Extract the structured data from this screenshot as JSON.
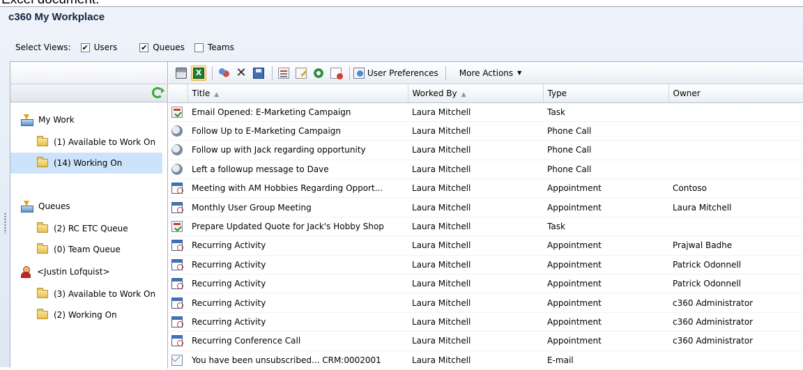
{
  "page_caption": "Excel document.",
  "app": {
    "title": "c360 My Workplace"
  },
  "views": {
    "label": "Select Views:",
    "options": [
      {
        "label": "Users",
        "checked": true
      },
      {
        "label": "Queues",
        "checked": true
      },
      {
        "label": "Teams",
        "checked": false
      }
    ],
    "check_glyph": "✔"
  },
  "toolbar": {
    "user_preferences": "User Preferences",
    "more_actions": "More Actions",
    "excel_glyph": "X",
    "delete_glyph": "✕",
    "caret": "▼"
  },
  "tree": {
    "my_work": "My Work",
    "available_to_work_on": "(1) Available to Work On",
    "working_on": "(14) Working On",
    "queues": "Queues",
    "rc_etc_queue": "(2) RC ETC Queue",
    "team_queue": "(0) Team Queue",
    "user": "<Justin Lofquist>",
    "user_available": "(3) Available to Work On",
    "user_working_on": "(2) Working On"
  },
  "grid": {
    "columns": [
      "Title",
      "Worked By",
      "Type",
      "Owner"
    ],
    "sort_glyph": "▲",
    "rows": [
      {
        "icon": "task",
        "title": "Email Opened: E-Marketing Campaign",
        "worked_by": "Laura Mitchell",
        "type": "Task",
        "owner": ""
      },
      {
        "icon": "phone",
        "title": "Follow Up to E-Marketing Campaign",
        "worked_by": "Laura Mitchell",
        "type": "Phone Call",
        "owner": ""
      },
      {
        "icon": "phone",
        "title": "Follow up with Jack regarding opportunity",
        "worked_by": "Laura Mitchell",
        "type": "Phone Call",
        "owner": ""
      },
      {
        "icon": "phone",
        "title": "Left a followup message to Dave",
        "worked_by": "Laura Mitchell",
        "type": "Phone Call",
        "owner": ""
      },
      {
        "icon": "appointment",
        "title": "Meeting with AM Hobbies Regarding Opport...",
        "worked_by": "Laura Mitchell",
        "type": "Appointment",
        "owner": "Contoso"
      },
      {
        "icon": "appointment",
        "title": "Monthly User Group Meeting",
        "worked_by": "Laura Mitchell",
        "type": "Appointment",
        "owner": "Laura Mitchell"
      },
      {
        "icon": "task",
        "title": "Prepare Updated Quote for Jack's Hobby Shop",
        "worked_by": "Laura Mitchell",
        "type": "Task",
        "owner": ""
      },
      {
        "icon": "appointment",
        "title": "Recurring Activity",
        "worked_by": "Laura Mitchell",
        "type": "Appointment",
        "owner": "Prajwal Badhe"
      },
      {
        "icon": "appointment",
        "title": "Recurring Activity",
        "worked_by": "Laura Mitchell",
        "type": "Appointment",
        "owner": "Patrick Odonnell"
      },
      {
        "icon": "appointment",
        "title": "Recurring Activity",
        "worked_by": "Laura Mitchell",
        "type": "Appointment",
        "owner": "Patrick Odonnell"
      },
      {
        "icon": "appointment",
        "title": "Recurring Activity",
        "worked_by": "Laura Mitchell",
        "type": "Appointment",
        "owner": "c360 Administrator"
      },
      {
        "icon": "appointment",
        "title": "Recurring Activity",
        "worked_by": "Laura Mitchell",
        "type": "Appointment",
        "owner": "c360 Administrator"
      },
      {
        "icon": "appointment",
        "title": "Recurring Conference Call",
        "worked_by": "Laura Mitchell",
        "type": "Appointment",
        "owner": "c360 Administrator"
      },
      {
        "icon": "email",
        "title": "You have been unsubscribed... CRM:0002001",
        "worked_by": "Laura Mitchell",
        "type": "E-mail",
        "owner": ""
      }
    ]
  }
}
